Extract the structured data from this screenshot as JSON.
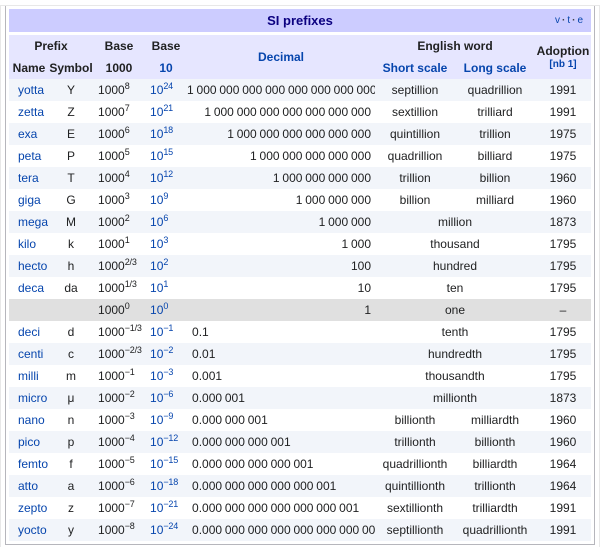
{
  "colors": {
    "title_bg": "#ccccff",
    "title_text": "#0b0080",
    "header_bg": "#e6e6ff",
    "link": "#0645ad",
    "row_alt_bg": "#f2f5fa",
    "row_one_bg": "#e0e0e0",
    "box_border": "#b6b6bc",
    "text": "#202122"
  },
  "title_bar": {
    "title": "SI prefixes",
    "vte": {
      "v": "v",
      "t": "t",
      "e": "e",
      "sep": "·"
    }
  },
  "header": {
    "prefix": "Prefix",
    "name": "Name",
    "symbol": "Symbol",
    "base": "Base",
    "base_1000": "1000",
    "base_10": "10",
    "decimal": "Decimal",
    "english_word": "English word",
    "short_scale": "Short scale",
    "long_scale": "Long scale",
    "adoption": "Adoption",
    "adoption_note": "[nb 1]"
  },
  "bases": {
    "b1000": "1000",
    "b10": "10"
  },
  "rows": [
    {
      "name": "yotta",
      "symbol": "Y",
      "b1000_exp": "8",
      "b10_exp": "24",
      "decimal": "1 000 000 000 000 000 000 000 000",
      "short": "septillion",
      "long": "quadrillion",
      "adoption": "1991"
    },
    {
      "name": "zetta",
      "symbol": "Z",
      "b1000_exp": "7",
      "b10_exp": "21",
      "decimal": "1 000 000 000 000 000 000 000",
      "short": "sextillion",
      "long": "trilliard",
      "adoption": "1991"
    },
    {
      "name": "exa",
      "symbol": "E",
      "b1000_exp": "6",
      "b10_exp": "18",
      "decimal": "1 000 000 000 000 000 000",
      "short": "quintillion",
      "long": "trillion",
      "adoption": "1975"
    },
    {
      "name": "peta",
      "symbol": "P",
      "b1000_exp": "5",
      "b10_exp": "15",
      "decimal": "1 000 000 000 000 000",
      "short": "quadrillion",
      "long": "billiard",
      "adoption": "1975"
    },
    {
      "name": "tera",
      "symbol": "T",
      "b1000_exp": "4",
      "b10_exp": "12",
      "decimal": "1 000 000 000 000",
      "short": "trillion",
      "long": "billion",
      "adoption": "1960"
    },
    {
      "name": "giga",
      "symbol": "G",
      "b1000_exp": "3",
      "b10_exp": "9",
      "decimal": "1 000 000 000",
      "short": "billion",
      "long": "milliard",
      "adoption": "1960"
    },
    {
      "name": "mega",
      "symbol": "M",
      "b1000_exp": "2",
      "b10_exp": "6",
      "decimal": "1 000 000",
      "english": "million",
      "adoption": "1873"
    },
    {
      "name": "kilo",
      "symbol": "k",
      "b1000_exp": "1",
      "b10_exp": "3",
      "decimal": "1 000",
      "english": "thousand",
      "adoption": "1795"
    },
    {
      "name": "hecto",
      "symbol": "h",
      "b1000_exp": "2/3",
      "b10_exp": "2",
      "decimal": "100",
      "english": "hundred",
      "adoption": "1795"
    },
    {
      "name": "deca",
      "symbol": "da",
      "b1000_exp": "1/3",
      "b10_exp": "1",
      "decimal": "10",
      "english": "ten",
      "adoption": "1795"
    },
    {
      "name": "",
      "symbol": "",
      "b1000_exp": "0",
      "b10_exp": "0",
      "decimal": "1",
      "english": "one",
      "adoption": "–",
      "special": true
    },
    {
      "name": "deci",
      "symbol": "d",
      "b1000_exp": "−1/3",
      "b10_exp": "−1",
      "decimal": "0.1",
      "english": "tenth",
      "adoption": "1795"
    },
    {
      "name": "centi",
      "symbol": "c",
      "b1000_exp": "−2/3",
      "b10_exp": "−2",
      "decimal": "0.01",
      "english": "hundredth",
      "adoption": "1795"
    },
    {
      "name": "milli",
      "symbol": "m",
      "b1000_exp": "−1",
      "b10_exp": "−3",
      "decimal": "0.001",
      "english": "thousandth",
      "adoption": "1795"
    },
    {
      "name": "micro",
      "symbol": "μ",
      "b1000_exp": "−2",
      "b10_exp": "−6",
      "decimal": "0.000 001",
      "english": "millionth",
      "adoption": "1873"
    },
    {
      "name": "nano",
      "symbol": "n",
      "b1000_exp": "−3",
      "b10_exp": "−9",
      "decimal": "0.000 000 001",
      "short": "billionth",
      "long": "milliardth",
      "adoption": "1960"
    },
    {
      "name": "pico",
      "symbol": "p",
      "b1000_exp": "−4",
      "b10_exp": "−12",
      "decimal": "0.000 000 000 001",
      "short": "trillionth",
      "long": "billionth",
      "adoption": "1960"
    },
    {
      "name": "femto",
      "symbol": "f",
      "b1000_exp": "−5",
      "b10_exp": "−15",
      "decimal": "0.000 000 000 000 001",
      "short": "quadrillionth",
      "long": "billiardth",
      "adoption": "1964"
    },
    {
      "name": "atto",
      "symbol": "a",
      "b1000_exp": "−6",
      "b10_exp": "−18",
      "decimal": "0.000 000 000 000 000 001",
      "short": "quintillionth",
      "long": "trillionth",
      "adoption": "1964"
    },
    {
      "name": "zepto",
      "symbol": "z",
      "b1000_exp": "−7",
      "b10_exp": "−21",
      "decimal": "0.000 000 000 000 000 000 001",
      "short": "sextillionth",
      "long": "trilliardth",
      "adoption": "1991"
    },
    {
      "name": "yocto",
      "symbol": "y",
      "b1000_exp": "−8",
      "b10_exp": "−24",
      "decimal": "0.000 000 000 000 000 000 000 001",
      "short": "septillionth",
      "long": "quadrillionth",
      "adoption": "1991"
    }
  ]
}
